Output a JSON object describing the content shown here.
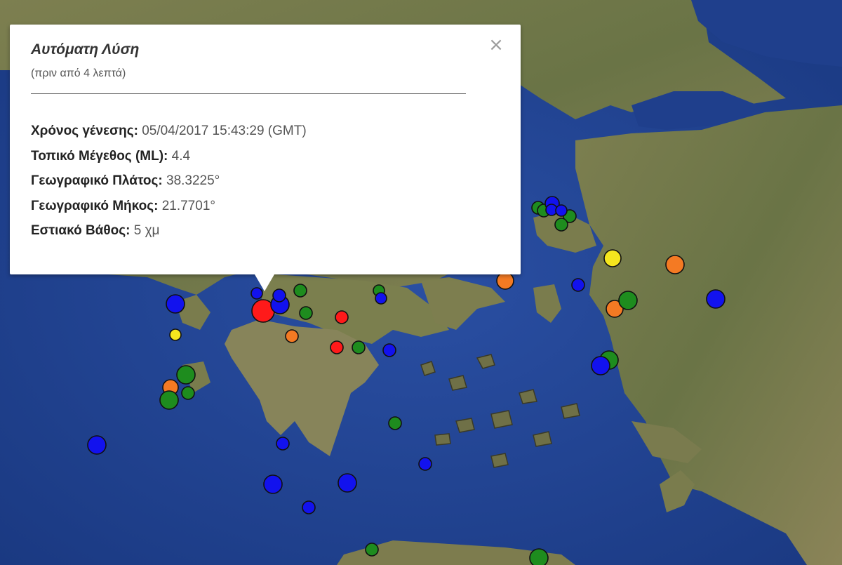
{
  "popup": {
    "title": "Αυτόματη Λύση",
    "subtitle": "(πριν από 4 λεπτά)",
    "close_glyph": "×",
    "fields": [
      {
        "label": "Χρόνος γένεσης:",
        "value": "05/04/2017  15:43:29 (GMT)"
      },
      {
        "label": "Τοπικό Μέγεθος (ML):",
        "value": "4.4"
      },
      {
        "label": "Γεωγραφικό Πλάτος:",
        "value": "38.3225°"
      },
      {
        "label": "Γεωγραφικό Μήκος:",
        "value": "21.7701°"
      },
      {
        "label": "Εστιακό Βάθος:",
        "value": "5 χμ"
      }
    ]
  },
  "legend_colors": {
    "red": "#ff1a1a",
    "orange": "#f47a23",
    "yellow": "#f5e61e",
    "green": "#1e8c1e",
    "blue": "#1212ee"
  },
  "map_colors": {
    "sea": "#1d3f8e",
    "land": "#6f7a4a",
    "land_light": "#8a8a5a"
  }
}
